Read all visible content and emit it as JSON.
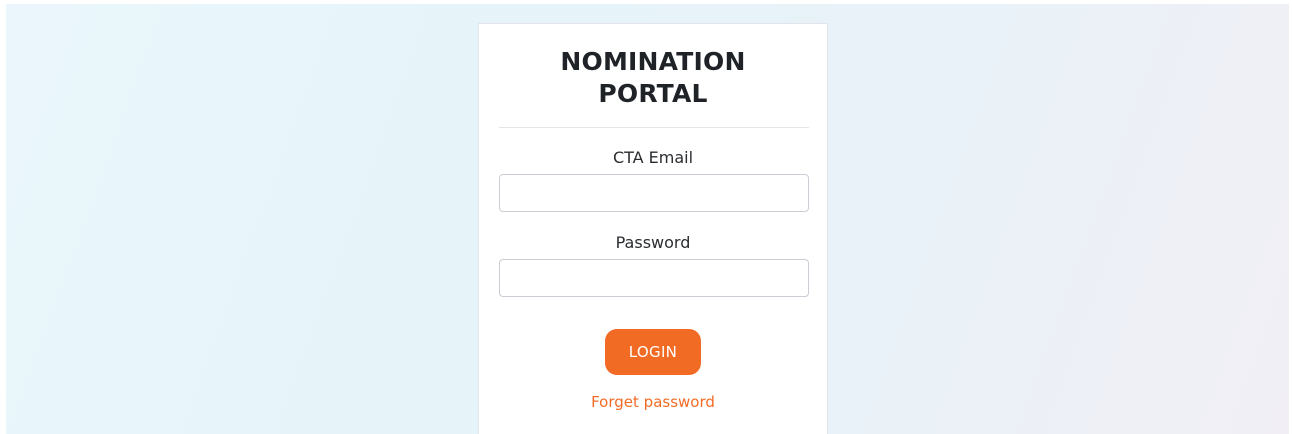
{
  "portal": {
    "title_line1": "NOMINATION",
    "title_line2": "PORTAL"
  },
  "form": {
    "email_label": "CTA Email",
    "email_value": "",
    "email_placeholder": "",
    "password_label": "Password",
    "password_value": "",
    "password_placeholder": "",
    "login_label": "LOGIN",
    "forgot_label": "Forget password"
  },
  "colors": {
    "accent": "#f26b25",
    "background_start": "#eaf6fb",
    "background_end": "#f1eff5",
    "card": "#ffffff",
    "text": "#1f2328"
  }
}
